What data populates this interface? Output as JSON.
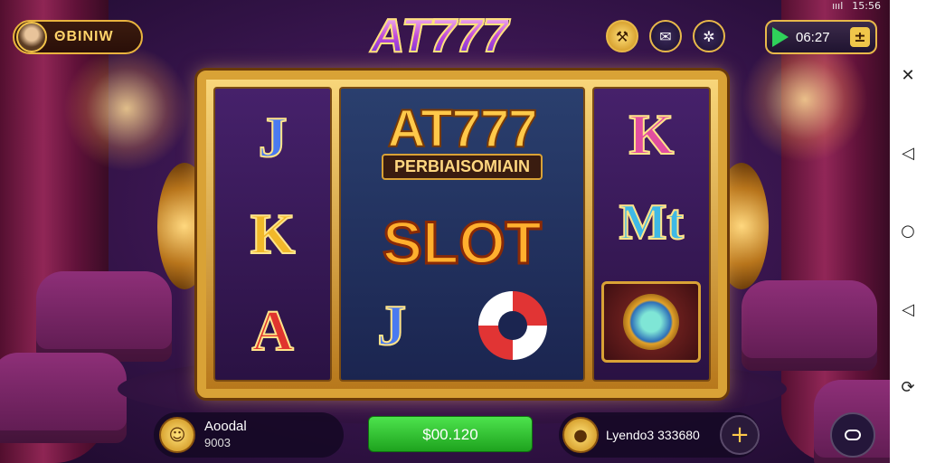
{
  "status_bar": {
    "time": "15:56",
    "signal": "ıııl"
  },
  "system_nav": {
    "close": "✕",
    "back": "◁",
    "home": "○",
    "recents": "◁",
    "rotate": "⟳"
  },
  "profile": {
    "name": "ΘBINIW"
  },
  "logo": {
    "title": "AT777"
  },
  "top_controls": {
    "icons": [
      "tools-icon",
      "gift-icon",
      "settings-icon"
    ],
    "timer": "06:27",
    "timer_plus": "±"
  },
  "machine": {
    "reel1": [
      "J",
      "K",
      "A"
    ],
    "center_title": "AT777",
    "center_subtitle": "PERBIAISOMIAIN",
    "center_slot": "SLOT",
    "center_bottom": [
      "J"
    ],
    "reel3": [
      "K",
      "Mt"
    ]
  },
  "bottom": {
    "left_label": "Aoodal",
    "left_value": "9003",
    "spin_label": "$00.120",
    "right_label": "Lyendo3 333680",
    "plus": "+"
  }
}
